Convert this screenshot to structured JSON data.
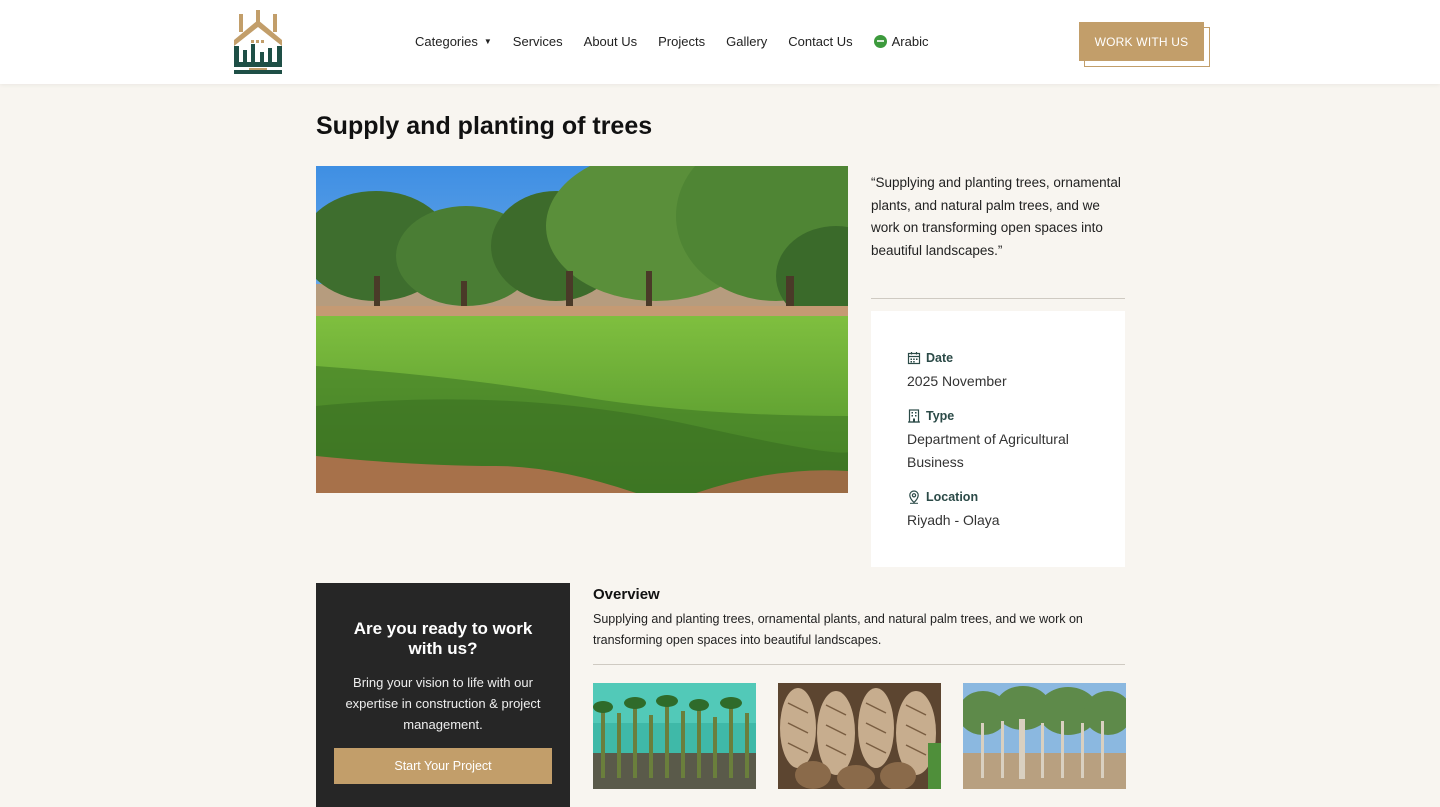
{
  "header": {
    "nav": [
      {
        "label": "Categories",
        "has_dropdown": true
      },
      {
        "label": "Services"
      },
      {
        "label": "About Us"
      },
      {
        "label": "Projects"
      },
      {
        "label": "Gallery"
      },
      {
        "label": "Contact Us"
      }
    ],
    "language_label": "Arabic",
    "cta_label": "WORK WITH US",
    "logo_icon": "company-logo",
    "colors": {
      "accent": "#c29e6a",
      "logo_green": "#1e4f46"
    }
  },
  "project": {
    "title": "Supply and planting of trees",
    "quote": "“Supplying and planting trees, ornamental plants, and natural palm trees, and we work on transforming open spaces into beautiful landscapes.”",
    "info": {
      "date_label": "Date",
      "date_value": "2025 November",
      "type_label": "Type",
      "type_value": "Department of Agricultural Business",
      "location_label": "Location",
      "location_value": "Riyadh - Olaya"
    }
  },
  "cta_panel": {
    "title": "Are you ready to work with us?",
    "text": "Bring your vision to life with our expertise in construction & project management.",
    "button_label": "Start Your Project"
  },
  "overview": {
    "title": "Overview",
    "text": "Supplying and planting trees, ornamental plants, and natural palm trees, and we work on transforming open spaces into beautiful landscapes."
  }
}
